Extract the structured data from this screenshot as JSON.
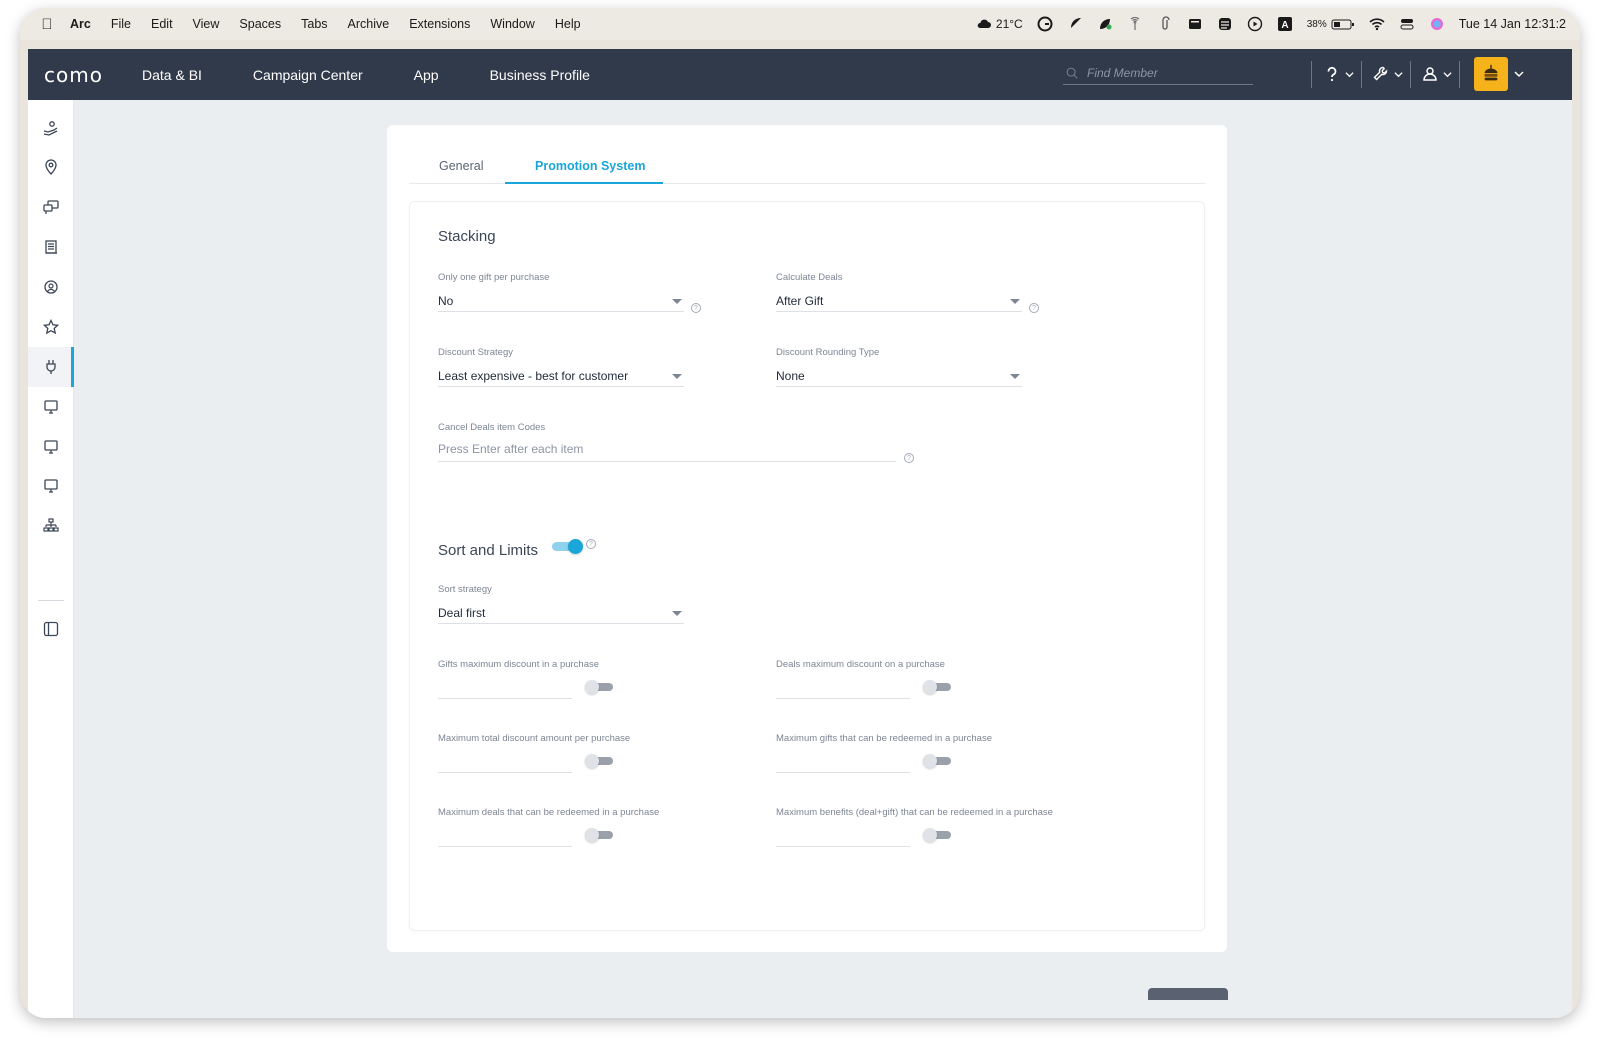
{
  "menubar": {
    "app": "Arc",
    "items": [
      "File",
      "Edit",
      "View",
      "Spaces",
      "Tabs",
      "Archive",
      "Extensions",
      "Window",
      "Help"
    ],
    "weather": "21°C",
    "battery": "38%",
    "datetime": "Tue 14 Jan  12:31:2"
  },
  "header": {
    "logo": "como",
    "nav": [
      "Data & BI",
      "Campaign Center",
      "App",
      "Business Profile"
    ],
    "search_placeholder": "Find Member"
  },
  "tabs": [
    {
      "label": "General",
      "active": false
    },
    {
      "label": "Promotion System",
      "active": true
    }
  ],
  "stacking": {
    "title": "Stacking",
    "one_gift_label": "Only one gift per purchase",
    "one_gift_value": "No",
    "calc_deals_label": "Calculate Deals",
    "calc_deals_value": "After Gift",
    "discount_strategy_label": "Discount Strategy",
    "discount_strategy_value": "Least expensive - best for customer",
    "rounding_label": "Discount Rounding Type",
    "rounding_value": "None",
    "cancel_codes_label": "Cancel Deals item Codes",
    "cancel_codes_placeholder": "Press Enter after each item"
  },
  "sort_limits": {
    "title": "Sort and Limits",
    "enabled": true,
    "sort_strategy_label": "Sort strategy",
    "sort_strategy_value": "Deal first",
    "limits": [
      {
        "label": "Gifts maximum discount in a purchase",
        "enabled": false
      },
      {
        "label": "Deals maximum discount on a purchase",
        "enabled": false
      },
      {
        "label": "Maximum total discount amount per purchase",
        "enabled": false
      },
      {
        "label": "Maximum gifts that can be redeemed in a purchase",
        "enabled": false
      },
      {
        "label": "Maximum deals that can be redeemed in a purchase",
        "enabled": false
      },
      {
        "label": "Maximum benefits (deal+gift) that can be redeemed in a purchase",
        "enabled": false
      }
    ]
  },
  "colors": {
    "header_bg": "#313a4a",
    "accent": "#1aa6d8",
    "brand_avatar": "#f6b21a"
  }
}
